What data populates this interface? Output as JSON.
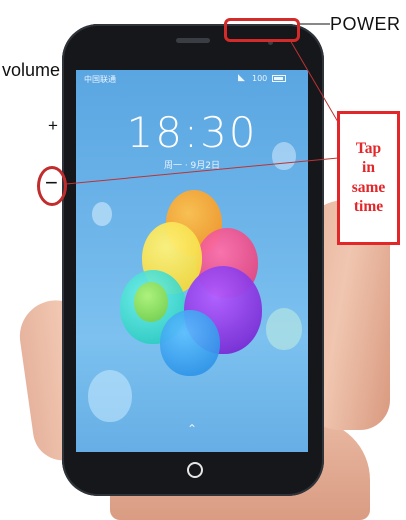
{
  "annotations": {
    "power_label": "POWER",
    "volume_label": "volume",
    "plus_label": "+",
    "minus_label": "−",
    "instruction_lines": [
      "Tap",
      "in",
      "same",
      "time"
    ],
    "highlight_color": "#e3262a"
  },
  "phone": {
    "status_bar": {
      "carrier": "中国联通",
      "signal_icon": "wifi-signal-icon",
      "battery_text": "100",
      "battery_icon": "battery-icon"
    },
    "lock_screen": {
      "time": "18:30",
      "date": "周一 · 9月2日",
      "unlock_hint_icon": "chevron-up-icon"
    },
    "home_button_icon": "home-ring-icon",
    "wallpaper_colors": [
      "#f5a623",
      "#e94b8a",
      "#f7e04a",
      "#2fd4c7",
      "#7b2fd9",
      "#3aa0f0"
    ]
  }
}
